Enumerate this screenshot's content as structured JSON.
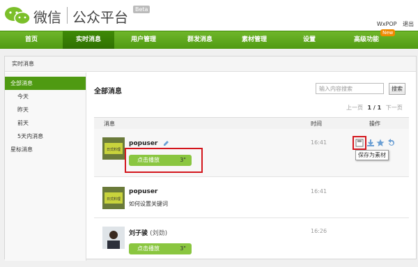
{
  "header": {
    "logo_text": "微信",
    "logo_sub": "公众平台",
    "beta": "Beta",
    "user_name": "WxPOP",
    "logout": "退出"
  },
  "nav": {
    "items": [
      "首页",
      "实时消息",
      "用户管理",
      "群发消息",
      "素材管理",
      "设置",
      "高级功能"
    ],
    "new_badge": "New"
  },
  "breadcrumb": "实时消息",
  "sidebar": {
    "items": [
      "全部消息",
      "今天",
      "昨天",
      "前天",
      "5天内消息",
      "星标消息"
    ]
  },
  "main": {
    "title": "全部消息",
    "search_placeholder": "输入内容搜索",
    "search_button": "搜索",
    "pager": {
      "prev": "上一页",
      "current": "1 / 1",
      "next": "下一页"
    },
    "columns": {
      "message": "消息",
      "time": "时间",
      "action": "操作"
    },
    "rows": [
      {
        "sender": "popuser",
        "voice_label": "点击播放",
        "duration": "3\"",
        "time": "16:41",
        "avatar_text": "日式料理"
      },
      {
        "sender": "popuser",
        "text": "如何设置关键词",
        "time": "16:41",
        "avatar_text": "日式料理"
      },
      {
        "sender": "刘子骏",
        "alias": "(刘劲)",
        "voice_label": "点击播放",
        "duration": "3\"",
        "time": "16:26"
      }
    ],
    "tooltip": "保存为素材"
  },
  "colors": {
    "brand_green": "#4f9a12",
    "highlight_red": "#d3151c",
    "voice_green": "#8ac640"
  }
}
